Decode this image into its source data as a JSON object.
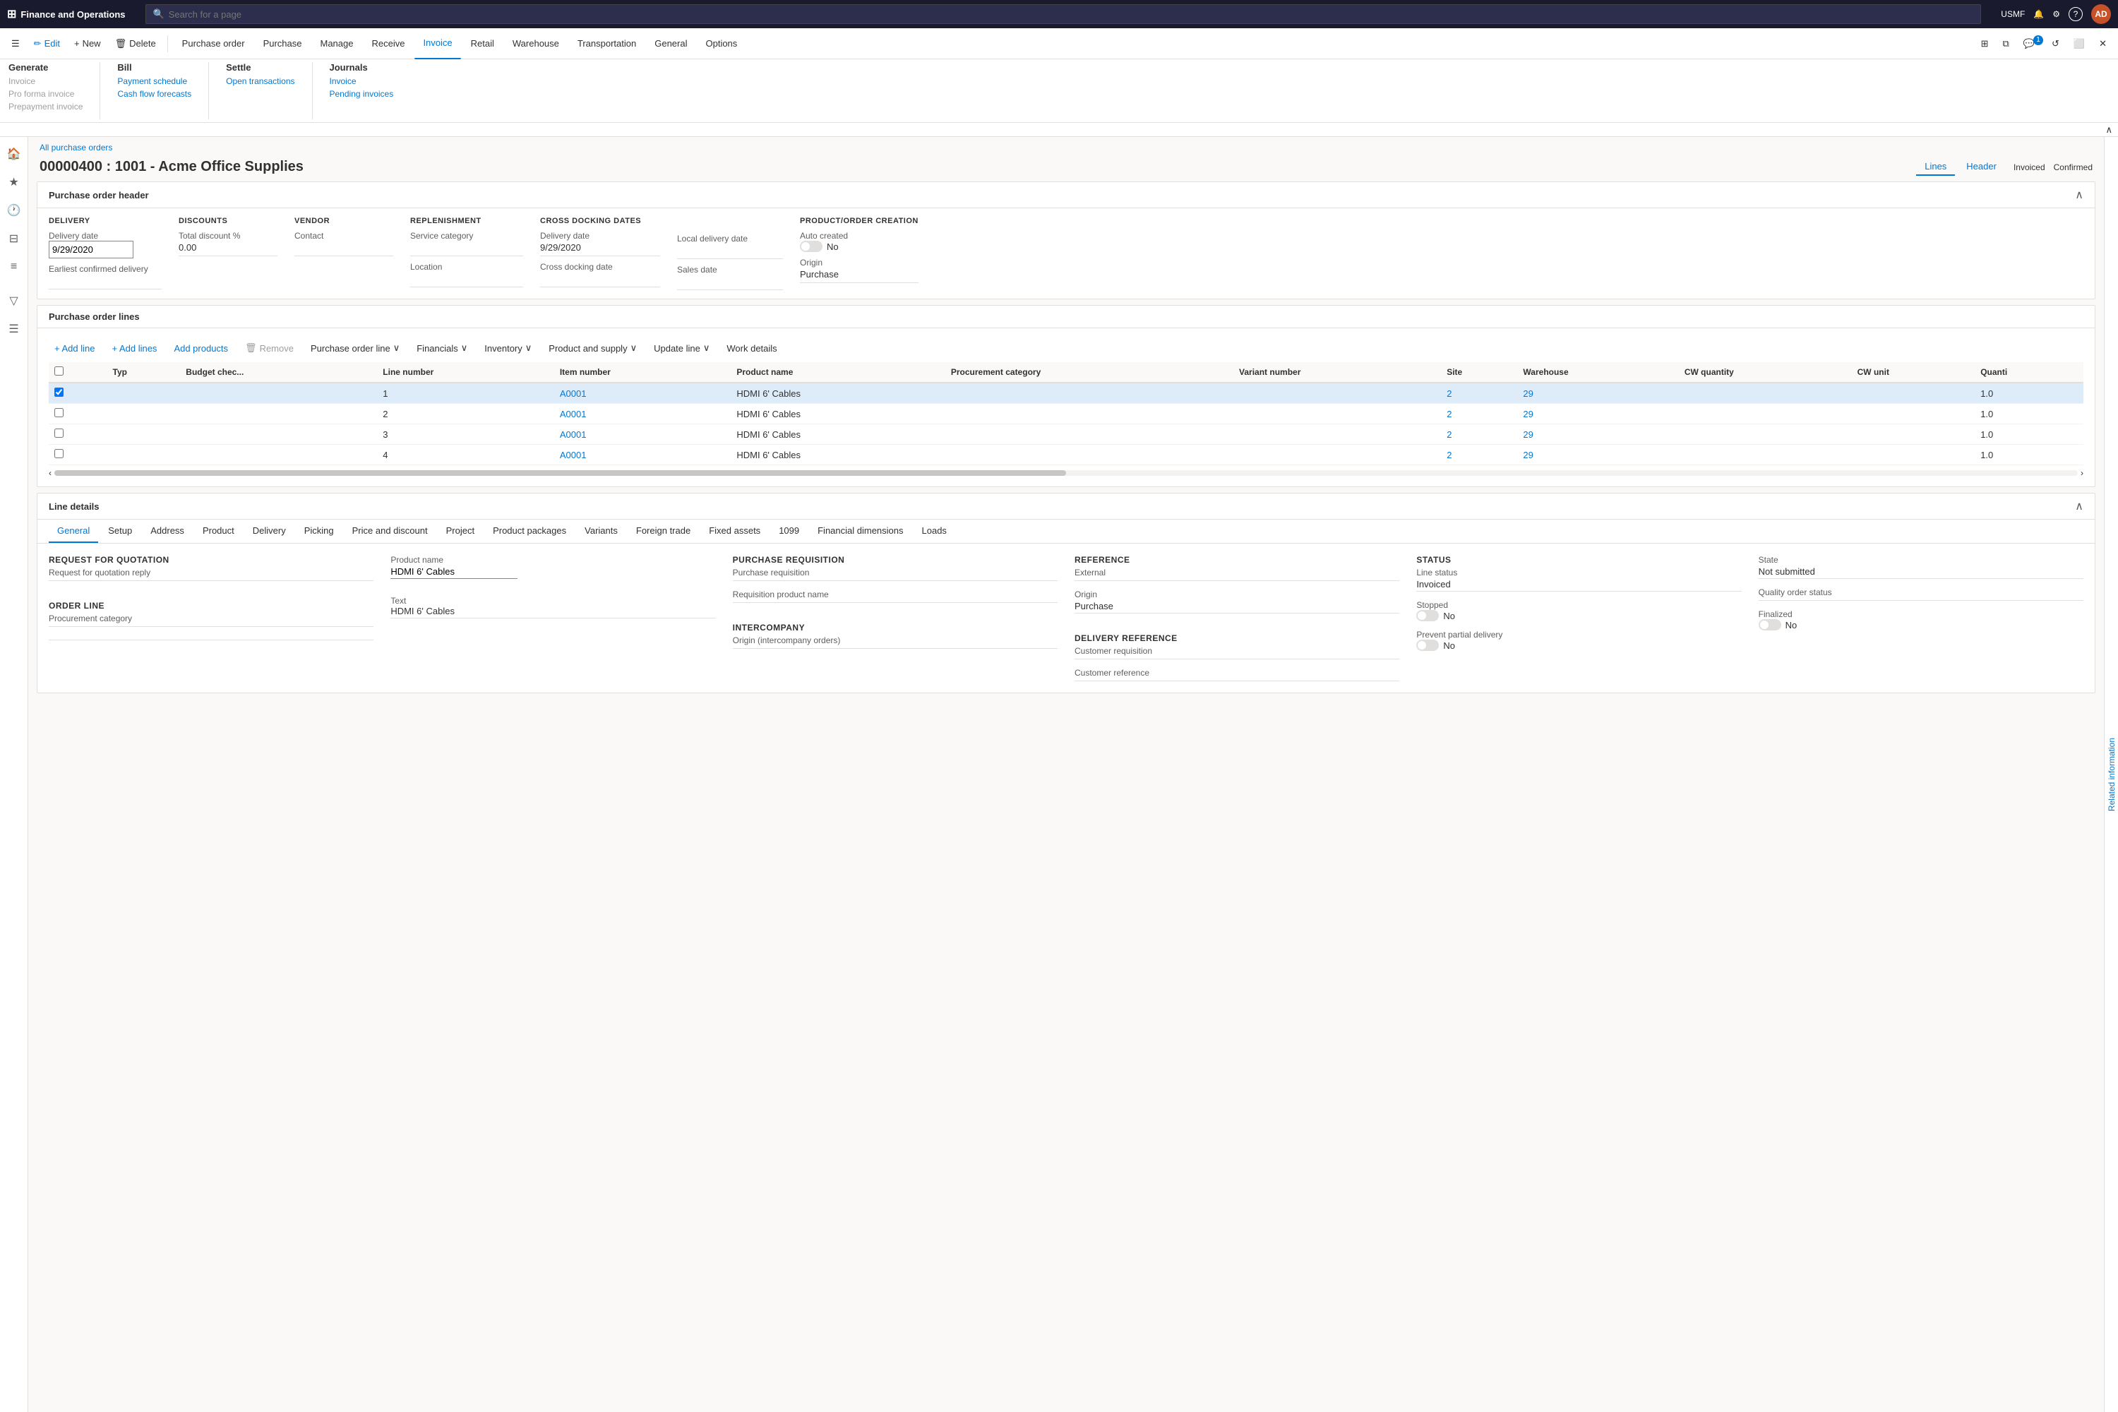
{
  "app": {
    "title": "Finance and Operations",
    "user": "USMF",
    "avatar": "AD"
  },
  "search": {
    "placeholder": "Search for a page"
  },
  "commandBar": {
    "edit": "Edit",
    "new": "New",
    "delete": "Delete",
    "tabs": [
      "Purchase order",
      "Purchase",
      "Manage",
      "Receive",
      "Invoice",
      "Retail",
      "Warehouse",
      "Transportation",
      "General",
      "Options"
    ],
    "activeTab": "Invoice"
  },
  "ribbon": {
    "generate": {
      "title": "Generate",
      "items": [
        "Invoice",
        "Pro forma invoice",
        "Prepayment invoice"
      ]
    },
    "bill": {
      "title": "Bill",
      "label": "Bill",
      "items": [
        "Payment schedule",
        "Cash flow forecasts"
      ]
    },
    "settle": {
      "title": "Settle",
      "label": "Settle",
      "items": [
        "Open transactions"
      ]
    },
    "journals": {
      "title": "Journals",
      "label": "Journals",
      "items": [
        "Invoice",
        "Pending invoices"
      ]
    }
  },
  "breadcrumb": "All purchase orders",
  "pageTitle": "00000400 : 1001 - Acme Office Supplies",
  "viewTabs": {
    "lines": "Lines",
    "header": "Header"
  },
  "status": {
    "invoiced": "Invoiced",
    "confirmed": "Confirmed"
  },
  "purchaseOrderHeader": {
    "sectionTitle": "Purchase order header",
    "delivery": {
      "label": "DELIVERY",
      "deliveryDate": {
        "label": "Delivery date",
        "value": "9/29/2020"
      },
      "earliestConfirmed": {
        "label": "Earliest confirmed delivery",
        "value": ""
      }
    },
    "discounts": {
      "label": "DISCOUNTS",
      "totalDiscount": {
        "label": "Total discount %",
        "value": "0.00"
      }
    },
    "vendor": {
      "label": "VENDOR",
      "contact": {
        "label": "Contact",
        "value": ""
      }
    },
    "replenishment": {
      "label": "REPLENISHMENT",
      "serviceCategory": {
        "label": "Service category",
        "value": ""
      },
      "location": {
        "label": "Location",
        "value": ""
      }
    },
    "crossDockingDates": {
      "label": "CROSS DOCKING DATES",
      "deliveryDate": {
        "label": "Delivery date",
        "value": "9/29/2020"
      },
      "crossDockingDate": {
        "label": "Cross docking date",
        "value": ""
      }
    },
    "localDelivery": {
      "label": "Local delivery date",
      "value": ""
    },
    "salesDate": {
      "label": "Sales date",
      "value": ""
    },
    "productOrderCreation": {
      "label": "PRODUCT/ORDER CREATION",
      "autoCreated": {
        "label": "Auto created",
        "value": "No"
      },
      "origin": {
        "label": "Origin",
        "value": "Purchase"
      }
    }
  },
  "purchaseOrderLines": {
    "sectionTitle": "Purchase order lines",
    "toolbar": {
      "addLine": "+ Add line",
      "addLines": "+ Add lines",
      "addProducts": "Add products",
      "remove": "Remove",
      "purchaseOrderLine": "Purchase order line",
      "financials": "Financials",
      "inventory": "Inventory",
      "productAndSupply": "Product and supply",
      "updateLine": "Update line",
      "workDetails": "Work details"
    },
    "columns": [
      "",
      "Typ",
      "Budget chec...",
      "Line number",
      "Item number",
      "Product name",
      "Procurement category",
      "Variant number",
      "Site",
      "Warehouse",
      "CW quantity",
      "CW unit",
      "Quanti"
    ],
    "rows": [
      {
        "lineNumber": "1",
        "itemNumber": "A0001",
        "productName": "HDMI 6' Cables",
        "procurementCategory": "",
        "variantNumber": "",
        "site": "2",
        "warehouse": "29",
        "cwQuantity": "",
        "cwUnit": "",
        "quantity": "1.0",
        "selected": true
      },
      {
        "lineNumber": "2",
        "itemNumber": "A0001",
        "productName": "HDMI 6' Cables",
        "procurementCategory": "",
        "variantNumber": "",
        "site": "2",
        "warehouse": "29",
        "cwQuantity": "",
        "cwUnit": "",
        "quantity": "1.0",
        "selected": false
      },
      {
        "lineNumber": "3",
        "itemNumber": "A0001",
        "productName": "HDMI 6' Cables",
        "procurementCategory": "",
        "variantNumber": "",
        "site": "2",
        "warehouse": "29",
        "cwQuantity": "",
        "cwUnit": "",
        "quantity": "1.0",
        "selected": false
      },
      {
        "lineNumber": "4",
        "itemNumber": "A0001",
        "productName": "HDMI 6' Cables",
        "procurementCategory": "",
        "variantNumber": "",
        "site": "2",
        "warehouse": "29",
        "cwQuantity": "",
        "cwUnit": "",
        "quantity": "1.0",
        "selected": false
      }
    ]
  },
  "lineDetails": {
    "sectionTitle": "Line details",
    "tabs": [
      "General",
      "Setup",
      "Address",
      "Product",
      "Delivery",
      "Picking",
      "Price and discount",
      "Project",
      "Product packages",
      "Variants",
      "Foreign trade",
      "Fixed assets",
      "1099",
      "Financial dimensions",
      "Loads"
    ],
    "activeTab": "General",
    "general": {
      "requestForQuotation": {
        "label": "REQUEST FOR QUOTATION",
        "requestReply": {
          "label": "Request for quotation reply",
          "value": ""
        }
      },
      "orderLine": {
        "label": "ORDER LINE",
        "procurementCategory": {
          "label": "Procurement category",
          "value": ""
        }
      },
      "productName": {
        "label": "Product name",
        "value": "HDMI 6' Cables"
      },
      "text": {
        "label": "Text",
        "value": "HDMI 6' Cables"
      },
      "purchaseRequisition": {
        "label": "PURCHASE REQUISITION",
        "purchaseRequisition": {
          "label": "Purchase requisition",
          "value": ""
        },
        "requisitionProductName": {
          "label": "Requisition product name",
          "value": ""
        }
      },
      "intercompany": {
        "label": "INTERCOMPANY",
        "originIntercompany": {
          "label": "Origin (intercompany orders)",
          "value": ""
        }
      },
      "reference": {
        "label": "REFERENCE",
        "external": {
          "label": "External",
          "value": ""
        },
        "origin": {
          "label": "Origin",
          "value": "Purchase"
        }
      },
      "deliveryReference": {
        "label": "DELIVERY REFERENCE",
        "customerRequisition": {
          "label": "Customer requisition",
          "value": ""
        },
        "customerReference": {
          "label": "Customer reference",
          "value": ""
        }
      },
      "status": {
        "label": "STATUS",
        "lineStatus": {
          "label": "Line status",
          "value": "Invoiced"
        },
        "stopped": {
          "label": "Stopped",
          "value": "No"
        },
        "preventPartialDelivery": {
          "label": "Prevent partial delivery",
          "value": "No"
        }
      },
      "state": {
        "label": "State",
        "value": "Not submitted",
        "qualityOrderStatus": {
          "label": "Quality order status",
          "value": ""
        },
        "finalized": {
          "label": "Finalized",
          "value": "No"
        }
      }
    }
  },
  "icons": {
    "search": "🔍",
    "bell": "🔔",
    "gear": "⚙",
    "help": "?",
    "grid": "⊞",
    "menu": "☰",
    "star": "★",
    "clock": "🕐",
    "bookmark": "⊟",
    "list": "≡",
    "filter": "▽",
    "edit": "✏",
    "plus": "+",
    "delete": "🗑",
    "collapse": "∧",
    "expand": "∨",
    "chevronDown": "∨",
    "chevronRight": "›",
    "back": "‹",
    "forward": "›",
    "refresh": "↻",
    "pin": "📌",
    "windows": "⊞",
    "copy": "⧉"
  }
}
